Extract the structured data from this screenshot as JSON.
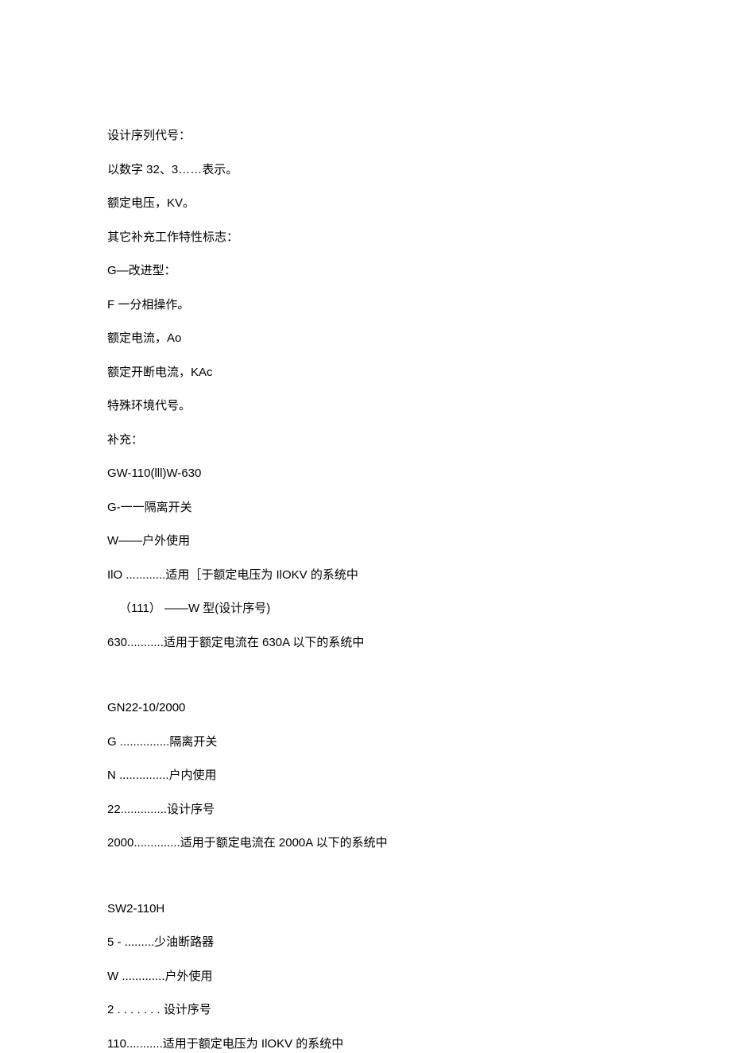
{
  "lines": [
    {
      "text": "设计序列代号：",
      "class": "line"
    },
    {
      "text": "以数字 32、3……表示。",
      "class": "line"
    },
    {
      "text": "额定电压，KV。",
      "class": "line"
    },
    {
      "text": "其它补充工作特性标志：",
      "class": "line"
    },
    {
      "text": "G—改进型：",
      "class": "line"
    },
    {
      "text": "F 一分相操作。",
      "class": "line"
    },
    {
      "text": "额定电流，Ao",
      "class": "line"
    },
    {
      "text": "额定开断电流，KAc",
      "class": "line"
    },
    {
      "text": "特殊环境代号。",
      "class": "line"
    },
    {
      "text": "补充：",
      "class": "line"
    },
    {
      "text": "GW-110(lll)W-630",
      "class": "line"
    },
    {
      "text": "G-一一隔离开关",
      "class": "line"
    },
    {
      "text": "W——户外使用",
      "class": "line"
    },
    {
      "text": "IlO ............适用［于额定电压为 IlOKV 的系统中",
      "class": "line"
    },
    {
      "text": "（111） ——W 型(设计序号)",
      "class": "line indent"
    },
    {
      "text": "630...........适用于额定电流在 630A 以下的系统中",
      "class": "line"
    },
    {
      "text": "",
      "class": "gap"
    },
    {
      "text": "GN22-10/2000",
      "class": "line"
    },
    {
      "text": "G ...............隔离开关",
      "class": "line"
    },
    {
      "text": "N ...............户内使用",
      "class": "line"
    },
    {
      "text": "22..............设计序号",
      "class": "line"
    },
    {
      "text": "2000..............适用于额定电流在 2000A 以下的系统中",
      "class": "line"
    },
    {
      "text": "",
      "class": "gap"
    },
    {
      "text": "SW2-110H",
      "class": "line"
    },
    {
      "text": "5    - .........少油断路器",
      "class": "line"
    },
    {
      "text": "W .............户外使用",
      "class": "line"
    },
    {
      "text": "2 . . . . . . . 设计序号",
      "class": "line"
    },
    {
      "text": "110...........适用于额定电压为 IlOKV 的系统中",
      "class": "line"
    }
  ]
}
